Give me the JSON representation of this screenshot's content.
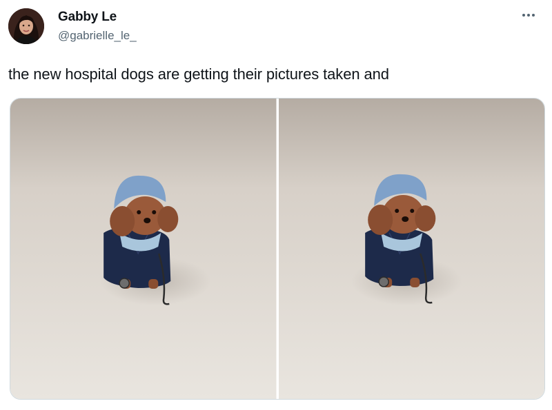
{
  "author": {
    "display_name": "Gabby Le",
    "handle": "@gabrielle_le_"
  },
  "tweet": {
    "text": "the new hospital dogs are getting their pictures taken and"
  },
  "icons": {
    "more": "more-options-icon"
  },
  "media": {
    "photos": [
      {
        "subject": "dog-in-scrubs-photo"
      },
      {
        "subject": "dog-in-scrubs-photo"
      }
    ]
  }
}
